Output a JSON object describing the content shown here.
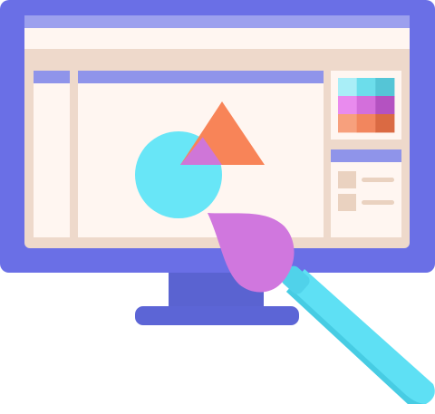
{
  "illustration": {
    "icon": "design-software-monitor-with-paintbrush",
    "colors": {
      "monitor_frame": "#6A6FE6",
      "monitor_stand": "#5A63D1",
      "monitor_base": "#5C65D6",
      "screen_bg": "#EED9CB",
      "title_bar_top": "#9CA0EE",
      "title_bar": "#FFF6F1",
      "panel_bg": "#FFF6F1",
      "panel_header": "#8F94EA",
      "triangle": "#F88458",
      "circle": "#68E6F7",
      "overlap": "#CF76D8",
      "palette_bg": "#FFF6F1",
      "palette_swatches": [
        "#A9EEF7",
        "#6CDDEB",
        "#55C5D6",
        "#E98BEE",
        "#D36FDB",
        "#B452C1",
        "#F7A07D",
        "#F2865E",
        "#DA6A43"
      ],
      "layer_thumb": "#EAD2C0",
      "layer_line": "#EAD2C0",
      "brush_tip": "#D077DE",
      "brush_handle": "#5EE0F4",
      "brush_handle_shade": "#47CCE3",
      "brush_ferrule": "#50D2EA"
    }
  }
}
